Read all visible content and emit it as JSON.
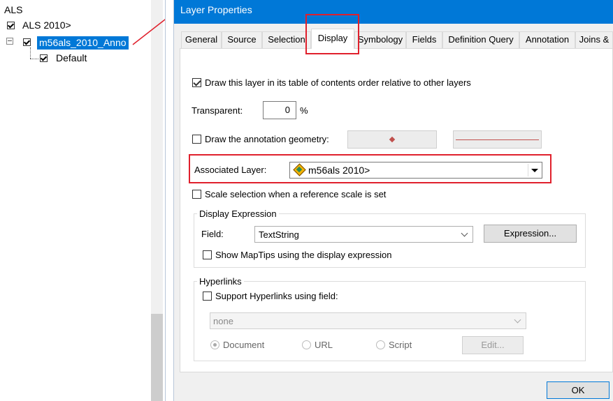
{
  "toc": {
    "root_label": "ALS",
    "items": [
      {
        "label": "ALS 2010>",
        "checked": true
      },
      {
        "label": "m56als_2010_Anno",
        "checked": true,
        "selected": true,
        "expander": "⊟"
      },
      {
        "label": "Default",
        "checked": true
      }
    ]
  },
  "dialog": {
    "title": "Layer Properties",
    "tabs": [
      "General",
      "Source",
      "Selection",
      "Display",
      "Symbology",
      "Fields",
      "Definition Query",
      "Annotation",
      "Joins &"
    ],
    "active_tab": "Display",
    "draw_order_label": "Draw this layer in its table of contents order relative to other layers",
    "transparent_label": "Transparent:",
    "transparent_value": "0",
    "transparent_unit": "%",
    "draw_geometry_label": "Draw the annotation geometry:",
    "associated_layer_label": "Associated Layer:",
    "associated_layer_value": "m56als 2010>",
    "scale_selection_label": "Scale selection when a reference scale is set",
    "display_expression": {
      "legend": "Display Expression",
      "field_label": "Field:",
      "field_value": "TextString",
      "expression_button": "Expression...",
      "maptips_label": "Show MapTips using the display expression"
    },
    "hyperlinks": {
      "legend": "Hyperlinks",
      "support_label": "Support Hyperlinks using field:",
      "field_value": "none",
      "options": [
        "Document",
        "URL",
        "Script"
      ],
      "edit_button": "Edit..."
    },
    "ok_button": "OK"
  },
  "colors": {
    "title_bar": "#0078d7",
    "highlight": "#e0202c",
    "selection": "#0078d7"
  }
}
